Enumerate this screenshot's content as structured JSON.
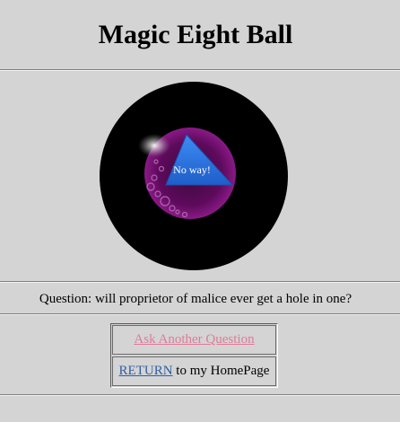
{
  "header": {
    "title": "Magic Eight Ball"
  },
  "ball": {
    "answer": "No way!"
  },
  "question": {
    "text": "Question: will proprietor of malice ever get a hole in one?"
  },
  "actions": {
    "ask_another_label": "Ask Another Question",
    "return_label": "RETURN",
    "return_suffix": " to my HomePage"
  },
  "colors": {
    "background": "#d4d4d4",
    "ball": "#000000",
    "window": "#6a0a66",
    "triangle": "#2a6fe0",
    "visited_link": "#e07a9a",
    "link": "#2f5fa8"
  }
}
